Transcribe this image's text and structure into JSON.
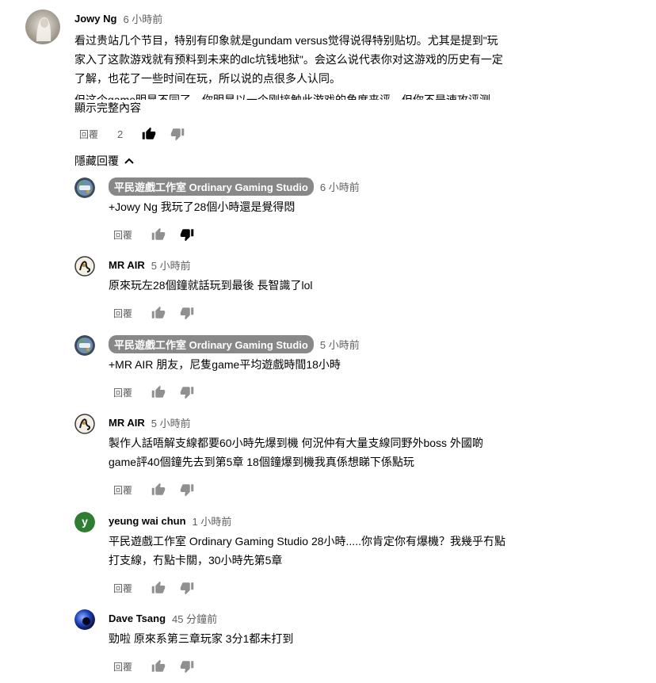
{
  "colors": {
    "secondary_text": "#606060",
    "pill_bg": "#888888",
    "avatar_y_bg": "#2e7d32"
  },
  "main_comment": {
    "author": "Jowy Ng",
    "time": "6 小時前",
    "lines": [
      "看过贵站几个节目，特别有印象就是gundam versus觉得说得特别贴切。尤其是提到\"玩",
      "家入了这款游戏就有预料到未来的dlc坑钱地狱\"。会这么说代表你对这游戏的历史有一定",
      "了解，也花了一些时间在玩，所以说的点很多人认同。"
    ],
    "truncated_line": "但这个game明显不同了，你明显以一个刚接触此游戏的角度来评。但你不是速攻评测，",
    "read_more": "顯示完整內容",
    "reply_label": "回覆",
    "like_count": "2"
  },
  "hide_replies_label": "隱藏回覆",
  "replies": [
    {
      "author": "平民遊戲工作室 Ordinary Gaming Studio",
      "time": "6 小時前",
      "lines": [
        "+Jowy Ng 我玩了28個小時還是覺得悶"
      ],
      "reply_label": "回覆",
      "avatar_icon": "studio-logo-icon"
    },
    {
      "author": "MR AIR",
      "time": "5 小時前",
      "lines": [
        "原來玩左28個鐘就話玩到最後 長智識了lol"
      ],
      "reply_label": "回覆",
      "avatar_icon": "ink-emblem-icon"
    },
    {
      "author": "平民遊戲工作室 Ordinary Gaming Studio",
      "time": "5 小時前",
      "lines": [
        "+MR AIR 朋友，尼隻game平均遊戲時間18小時"
      ],
      "reply_label": "回覆",
      "avatar_icon": "studio-logo-icon"
    },
    {
      "author": "MR AIR",
      "time": "5 小時前",
      "lines": [
        "製作人話唔解支線都要60小時先爆到機 何況仲有大量支線同野外boss 外國啲",
        "game評40個鐘先去到第5章 18個鐘爆到機我真係想睇下係點玩"
      ],
      "reply_label": "回覆",
      "avatar_icon": "ink-emblem-icon"
    },
    {
      "author": "yeung wai chun",
      "time": "1 小時前",
      "lines": [
        "平民遊戲工作室 Ordinary Gaming Studio 28小時.....你肯定你有爆機？我幾乎冇點",
        "打支線，冇點卡關，30小時先第5章"
      ],
      "reply_label": "回覆",
      "avatar_letter": "y"
    },
    {
      "author": "Dave Tsang",
      "time": "45 分鐘前",
      "lines": [
        "勁啦 原來系第三章玩家 3分1都未打到"
      ],
      "reply_label": "回覆",
      "avatar_icon": "blue-orb-icon"
    }
  ]
}
